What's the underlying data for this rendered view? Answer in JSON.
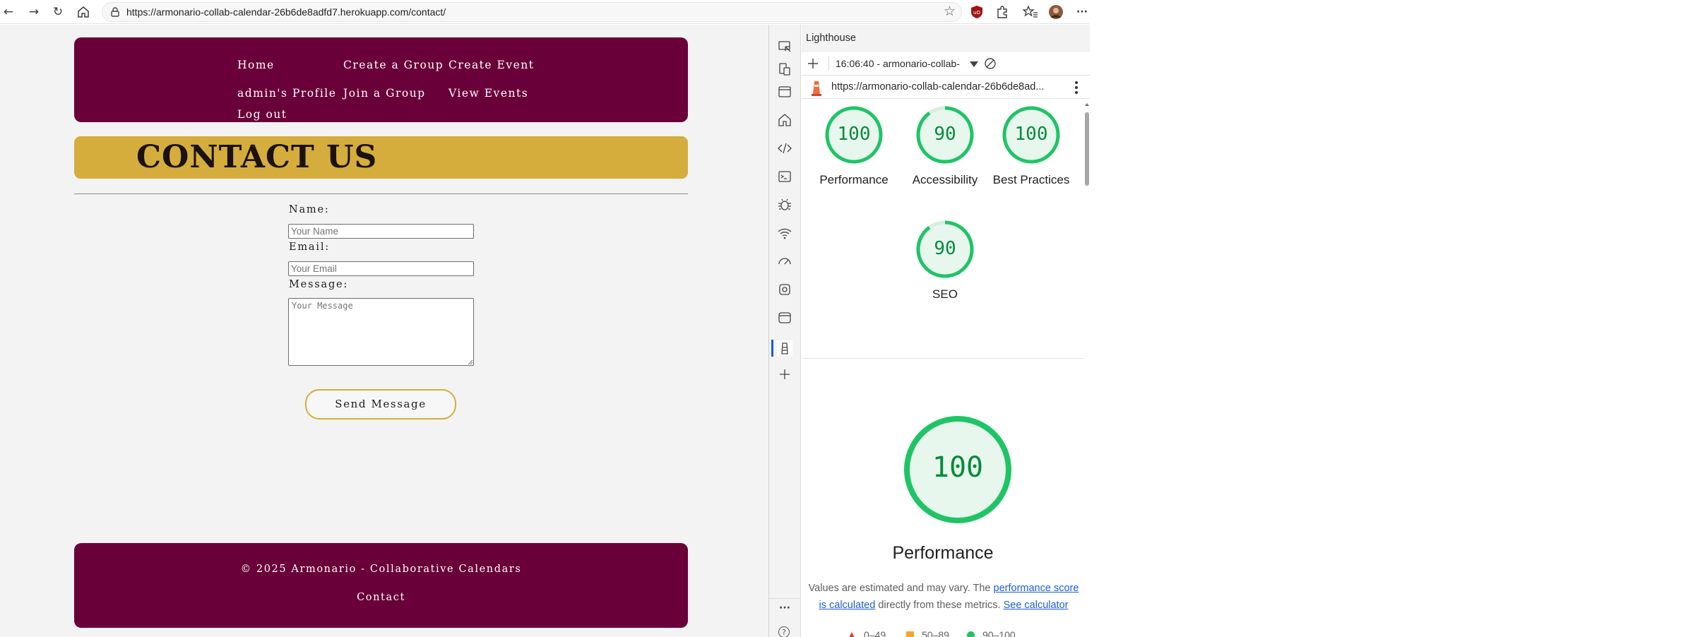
{
  "browser": {
    "url": "https://armonario-collab-calendar-26b6de8adfd7.herokuapp.com/contact/",
    "nav_back_glyph": "←",
    "nav_forward_glyph": "→",
    "nav_reload_glyph": "↻",
    "star_glyph": "☆",
    "more_glyph": "···"
  },
  "site_nav": {
    "home": "Home",
    "create_group": "Create a Group",
    "create_event": "Create Event",
    "profile": "admin's Profile",
    "join_group": "Join a Group",
    "view_events": "View Events",
    "logout": "Log out"
  },
  "hero": {
    "title": "CONTACT US"
  },
  "form": {
    "name_label": "Name:",
    "name_placeholder": "Your Name",
    "email_label": "Email:",
    "email_placeholder": "Your Email",
    "message_label": "Message:",
    "message_placeholder": "Your Message",
    "submit_label": "Send Message"
  },
  "footer": {
    "copyright": "© 2025 Armonario - Collaborative Calendars",
    "contact_link": "Contact"
  },
  "devtools": {
    "panel_title": "Lighthouse",
    "report_selector": "16:06:40 - armonario-collab-",
    "report_url": "https://armonario-collab-calendar-26b6de8ad...",
    "more_tools": "···",
    "help": "?",
    "scores": [
      {
        "label": "Performance",
        "value": 100
      },
      {
        "label": "Accessibility",
        "value": 90
      },
      {
        "label": "Best Practices",
        "value": 100
      },
      {
        "label": "SEO",
        "value": 90
      }
    ],
    "summary": {
      "score": 100,
      "label": "Performance",
      "desc_prefix": "Values are estimated and may vary. The ",
      "desc_link1": "performance score is calculated",
      "desc_mid": " directly from these metrics. ",
      "desc_link2": "See calculator"
    },
    "legend": [
      {
        "range": "0–49",
        "color": "#e53935"
      },
      {
        "range": "50–89",
        "color": "#f4a52a"
      },
      {
        "range": "90–100",
        "color": "#1fc466"
      }
    ],
    "colors": {
      "pass": "#1fc466",
      "pass_bg": "#e8f7ee",
      "pass_text": "#078a3b"
    }
  },
  "colors": {
    "brand": "#6a0039",
    "accent": "#d4ad3c",
    "page_bg": "#f3f3f3"
  }
}
